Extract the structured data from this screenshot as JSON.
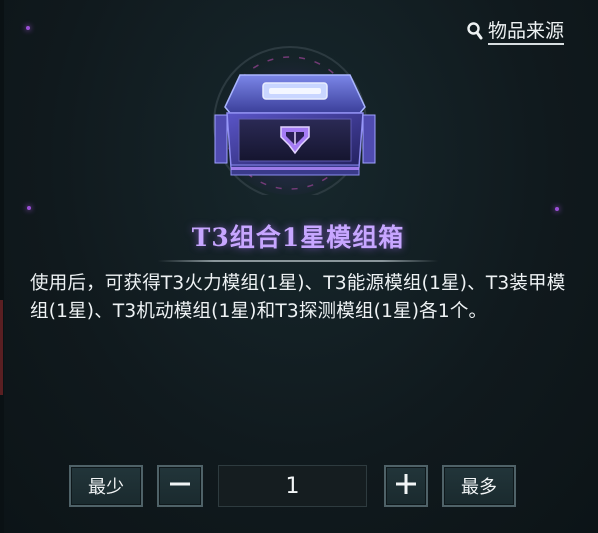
{
  "header": {
    "source_label": "物品来源",
    "source_icon": "magnifier-icon"
  },
  "item": {
    "name": "T3组合1星模组箱",
    "icon": "purple-module-chest-icon",
    "description": "使用后，可获得T3火力模组(1星)、T3能源模组(1星)、T3装甲模组(1星)、T3机动模组(1星)和T3探测模组(1星)各1个。"
  },
  "quantity": {
    "min_label": "最少",
    "minus_symbol": "−",
    "value": "1",
    "plus_symbol": "+",
    "max_label": "最多"
  },
  "colors": {
    "title": "#c7a6ff",
    "glow": "#b45cf0",
    "background": "#10191d"
  }
}
